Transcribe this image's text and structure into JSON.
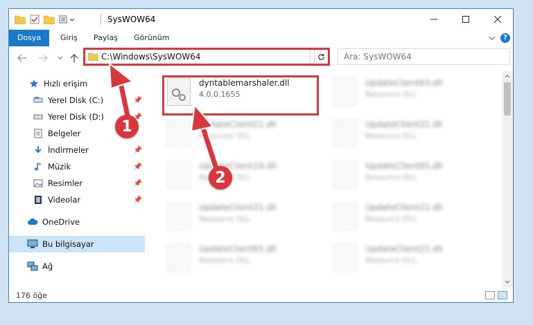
{
  "window": {
    "title": "SysWOW64"
  },
  "ribbon": {
    "tabs": [
      "Dosya",
      "Giriş",
      "Paylaş",
      "Görünüm"
    ]
  },
  "address": {
    "path": "C:\\Windows\\SysWOW64"
  },
  "search": {
    "placeholder": "Ara: SysWOW64"
  },
  "sidebar": {
    "items": [
      {
        "label": "Hızlı erişim",
        "icon": "star-icon"
      },
      {
        "label": "Yerel Disk (C:)",
        "icon": "drive-icon"
      },
      {
        "label": "Yerel Disk (D:)",
        "icon": "drive-icon"
      },
      {
        "label": "Belgeler",
        "icon": "documents-icon"
      },
      {
        "label": "İndirmeler",
        "icon": "download-icon"
      },
      {
        "label": "Müzik",
        "icon": "music-icon"
      },
      {
        "label": "Resimler",
        "icon": "pictures-icon"
      },
      {
        "label": "Videolar",
        "icon": "videos-icon"
      },
      {
        "label": "OneDrive",
        "icon": "cloud-icon"
      },
      {
        "label": "Bu bilgisayar",
        "icon": "computer-icon"
      },
      {
        "label": "Ağ",
        "icon": "network-icon"
      }
    ]
  },
  "files": {
    "highlighted": {
      "name": "dyntablemarshaler.dll",
      "desc": "4.0.0.1655"
    },
    "blurred": [
      {
        "name": "UpdateClient63.dll",
        "desc": "Resource DLL"
      },
      {
        "name": "UpdateClient21.dll",
        "desc": "Resource DLL"
      },
      {
        "name": "UpdateClient21.dll",
        "desc": "Resource DLL"
      },
      {
        "name": "UpdateClient19.dll",
        "desc": "Resource DLL"
      },
      {
        "name": "UpdateClient65.dll",
        "desc": "Resource DLL"
      },
      {
        "name": "UpdateClient21.dll",
        "desc": "Resource DLL"
      },
      {
        "name": "UpdateClient21.dll",
        "desc": "Resource DLL"
      },
      {
        "name": "UpdateClient65.dll",
        "desc": "Resource DLL"
      },
      {
        "name": "UpdateClient21.dll",
        "desc": "Resource DLL"
      }
    ]
  },
  "status": {
    "count": "176 öğe"
  },
  "annotations": {
    "step1": "1",
    "step2": "2"
  },
  "colors": {
    "accent": "#1979ca",
    "highlight": "#d9363e",
    "selected": "#cce4f7"
  }
}
